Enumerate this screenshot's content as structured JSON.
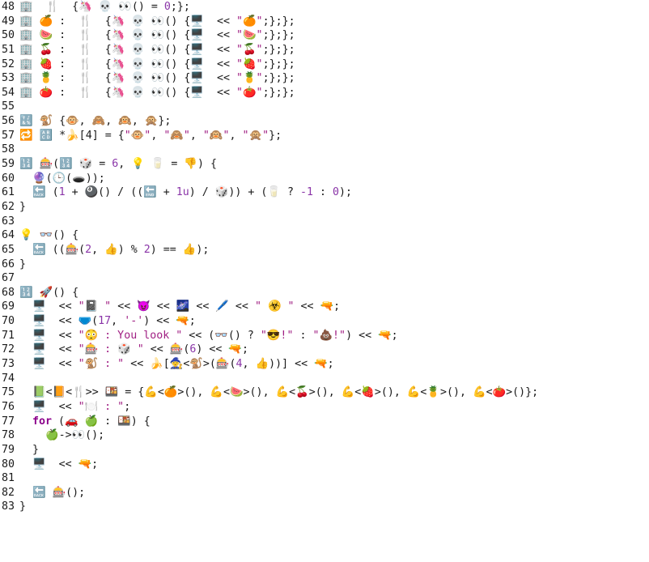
{
  "editor": {
    "lines": [
      {
        "n": "48",
        "segs": [
          [
            "plain",
            "🏢  🍴  {"
          ],
          [
            "plain",
            "🦄 💀 👀"
          ],
          [
            "plain",
            "() = "
          ],
          [
            "num",
            "0"
          ],
          [
            "plain",
            ";};"
          ]
        ]
      },
      {
        "n": "49",
        "segs": [
          [
            "plain",
            "🏢 🍊 :  🍴  {🦄 💀 👀() {🖥️  << "
          ],
          [
            "str",
            "\"🍊\""
          ],
          [
            "plain",
            ";};};"
          ]
        ]
      },
      {
        "n": "50",
        "segs": [
          [
            "plain",
            "🏢 🍉 :  🍴  {🦄 💀 👀() {🖥️  << "
          ],
          [
            "str",
            "\"🍉\""
          ],
          [
            "plain",
            ";};};"
          ]
        ]
      },
      {
        "n": "51",
        "segs": [
          [
            "plain",
            "🏢 🍒 :  🍴  {🦄 💀 👀() {🖥️  << "
          ],
          [
            "str",
            "\"🍒\""
          ],
          [
            "plain",
            ";};};"
          ]
        ]
      },
      {
        "n": "52",
        "segs": [
          [
            "plain",
            "🏢 🍓 :  🍴  {🦄 💀 👀() {🖥️  << "
          ],
          [
            "str",
            "\"🍓\""
          ],
          [
            "plain",
            ";};};"
          ]
        ]
      },
      {
        "n": "53",
        "segs": [
          [
            "plain",
            "🏢 🍍 :  🍴  {🦄 💀 👀() {🖥️  << "
          ],
          [
            "str",
            "\"🍍\""
          ],
          [
            "plain",
            ";};};"
          ]
        ]
      },
      {
        "n": "54",
        "segs": [
          [
            "plain",
            "🏢 🍅 :  🍴  {🦄 💀 👀() {🖥️  << "
          ],
          [
            "str",
            "\"🍅\""
          ],
          [
            "plain",
            ";};};"
          ]
        ]
      },
      {
        "n": "55",
        "segs": []
      },
      {
        "n": "56",
        "segs": [
          [
            "plain",
            "🔣 🐒 {🐵, 🙈, 🙉, 🙊};"
          ]
        ]
      },
      {
        "n": "57",
        "segs": [
          [
            "plain",
            "🔁 🔠 *🍌[4] = {"
          ],
          [
            "str",
            "\"🐵\""
          ],
          [
            "plain",
            ", "
          ],
          [
            "str",
            "\"🙈\""
          ],
          [
            "plain",
            ", "
          ],
          [
            "str",
            "\"🙉\""
          ],
          [
            "plain",
            ", "
          ],
          [
            "str",
            "\"🙊\""
          ],
          [
            "plain",
            "};"
          ]
        ]
      },
      {
        "n": "58",
        "segs": []
      },
      {
        "n": "59",
        "segs": [
          [
            "plain",
            "🔢 🎰(🔢 🎲 = "
          ],
          [
            "num",
            "6"
          ],
          [
            "plain",
            ", 💡 🥛 = 👎) {"
          ]
        ]
      },
      {
        "n": "60",
        "segs": [
          [
            "plain",
            "  🔮(🕒(🕳️));"
          ]
        ]
      },
      {
        "n": "61",
        "segs": [
          [
            "plain",
            "  🔙 ("
          ],
          [
            "num",
            "1"
          ],
          [
            "plain",
            " + 🎱() / ((🔚 + "
          ],
          [
            "num",
            "1u"
          ],
          [
            "plain",
            ") / 🎲)) + (🥛 ? "
          ],
          [
            "num",
            "-1"
          ],
          [
            "plain",
            " : "
          ],
          [
            "num",
            "0"
          ],
          [
            "plain",
            ");"
          ]
        ]
      },
      {
        "n": "62",
        "segs": [
          [
            "plain",
            "}"
          ]
        ]
      },
      {
        "n": "63",
        "segs": []
      },
      {
        "n": "64",
        "segs": [
          [
            "plain",
            "💡 👓() {"
          ]
        ]
      },
      {
        "n": "65",
        "segs": [
          [
            "plain",
            "  🔙 ((🎰("
          ],
          [
            "num",
            "2"
          ],
          [
            "plain",
            ", 👍) % "
          ],
          [
            "num",
            "2"
          ],
          [
            "plain",
            ") == 👍);"
          ]
        ]
      },
      {
        "n": "66",
        "segs": [
          [
            "plain",
            "}"
          ]
        ]
      },
      {
        "n": "67",
        "segs": []
      },
      {
        "n": "68",
        "segs": [
          [
            "plain",
            "🔢 🚀() {"
          ]
        ]
      },
      {
        "n": "69",
        "segs": [
          [
            "plain",
            "  🖥️  << "
          ],
          [
            "str",
            "\"📓 \""
          ],
          [
            "plain",
            " << 😈 << 🌌 << 🖊️ << "
          ],
          [
            "str",
            "\" ☣️ \""
          ],
          [
            "plain",
            " << 🔫;"
          ]
        ]
      },
      {
        "n": "70",
        "segs": [
          [
            "plain",
            "  🖥️  << 🩲("
          ],
          [
            "num",
            "17"
          ],
          [
            "plain",
            ", "
          ],
          [
            "str",
            "'-'"
          ],
          [
            "plain",
            ") << 🔫;"
          ]
        ]
      },
      {
        "n": "71",
        "segs": [
          [
            "plain",
            "  🖥️  << "
          ],
          [
            "str",
            "\"😳 : You look \""
          ],
          [
            "plain",
            " << (👓() ? "
          ],
          [
            "str",
            "\"😎!\""
          ],
          [
            "plain",
            " : "
          ],
          [
            "str",
            "\"💩!\""
          ],
          [
            "plain",
            ") << 🔫;"
          ]
        ]
      },
      {
        "n": "72",
        "segs": [
          [
            "plain",
            "  🖥️  << "
          ],
          [
            "str",
            "\"🎰 : 🎲 \""
          ],
          [
            "plain",
            " << 🎰("
          ],
          [
            "num",
            "6"
          ],
          [
            "plain",
            ") << 🔫;"
          ]
        ]
      },
      {
        "n": "73",
        "segs": [
          [
            "plain",
            "  🖥️  << "
          ],
          [
            "str",
            "\"🐒 : \""
          ],
          [
            "plain",
            " << 🍌[🧙<🐒>(🎰("
          ],
          [
            "num",
            "4"
          ],
          [
            "plain",
            ", 👍))] << 🔫;"
          ]
        ]
      },
      {
        "n": "74",
        "segs": []
      },
      {
        "n": "75",
        "segs": [
          [
            "plain",
            "  📗<📙<🍴>> 🍱 = {💪<🍊>(), 💪<🍉>(), 💪<🍒>(), 💪<🍓>(), 💪<🍍>(), 💪<🍅>()};"
          ]
        ]
      },
      {
        "n": "76",
        "segs": [
          [
            "plain",
            "  🖥️  << "
          ],
          [
            "str",
            "\"🍽️ : \""
          ],
          [
            "plain",
            ";"
          ]
        ]
      },
      {
        "n": "77",
        "segs": [
          [
            "plain",
            "  "
          ],
          [
            "kw",
            "for"
          ],
          [
            "plain",
            " (🚗 🍏 : 🍱) {"
          ]
        ]
      },
      {
        "n": "78",
        "segs": [
          [
            "plain",
            "    🍏->👀();"
          ]
        ]
      },
      {
        "n": "79",
        "segs": [
          [
            "plain",
            "  }"
          ]
        ]
      },
      {
        "n": "80",
        "segs": [
          [
            "plain",
            "  🖥️  << 🔫;"
          ]
        ]
      },
      {
        "n": "81",
        "segs": []
      },
      {
        "n": "82",
        "segs": [
          [
            "plain",
            "  🔙 🎰();"
          ]
        ]
      },
      {
        "n": "83",
        "segs": [
          [
            "plain",
            "}"
          ]
        ]
      }
    ]
  }
}
